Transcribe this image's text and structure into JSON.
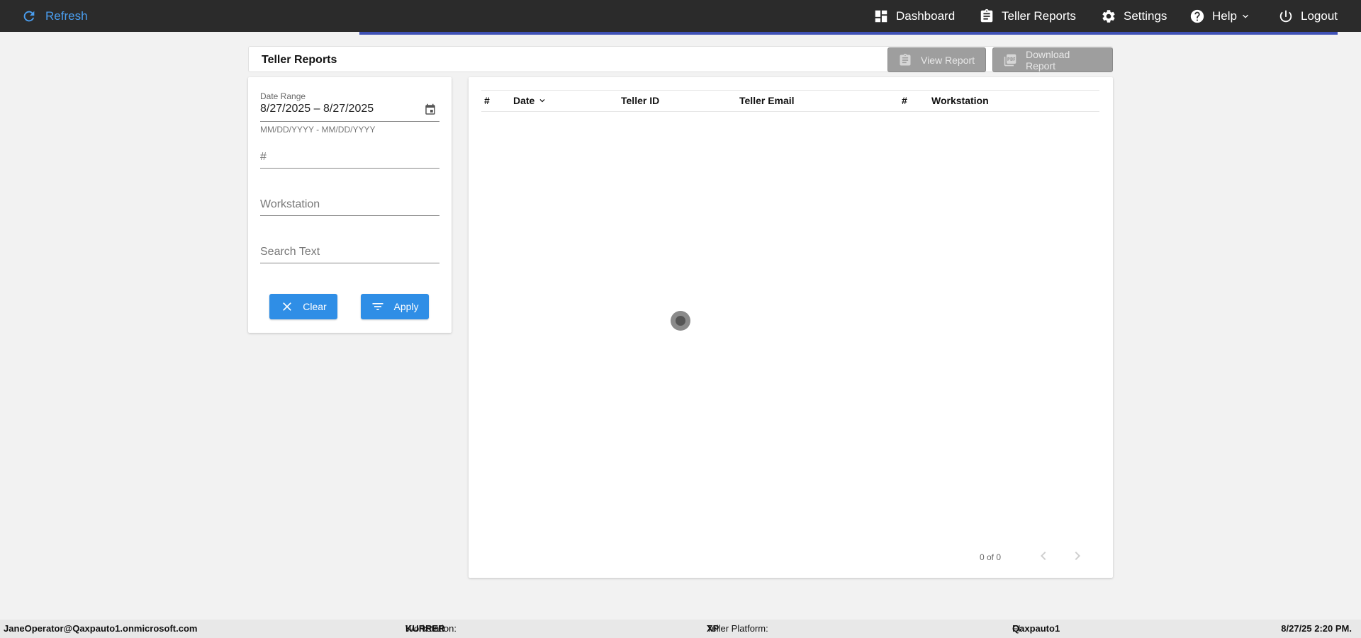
{
  "topbar": {
    "refresh_label": "Refresh",
    "nav": {
      "dashboard": "Dashboard",
      "teller_reports": "Teller Reports",
      "settings": "Settings",
      "help": "Help",
      "logout": "Logout"
    }
  },
  "page": {
    "title": "Teller Reports",
    "view_report_label": "View Report",
    "download_report_label": "Download Report"
  },
  "filters": {
    "date_range_label": "Date Range",
    "date_range_value": "8/27/2025 – 8/27/2025",
    "date_range_hint": "MM/DD/YYYY - MM/DD/YYYY",
    "number_placeholder": "#",
    "workstation_placeholder": "Workstation",
    "search_placeholder": "Search Text",
    "clear_label": "Clear",
    "apply_label": "Apply"
  },
  "table": {
    "columns": [
      "#",
      "Date",
      "Teller ID",
      "Teller Email",
      "#",
      "Workstation"
    ],
    "rows": [],
    "pagination": "0 of 0"
  },
  "footer": {
    "user": "JaneOperator@Qaxpauto1.onmicrosoft.com",
    "workstation_label": "Workstation: ",
    "workstation_value": "KURRER",
    "platform_label": "Teller Platform: ",
    "platform_value": "XP",
    "fi_label": "FI: ",
    "fi_value": "Qaxpauto1",
    "datetime": "8/27/25 2:20 PM."
  },
  "colors": {
    "topbar": "#2b2b2b",
    "accent_line": "#3f51b5",
    "refresh_text": "#4a9ef0",
    "primary_button": "#2f8ee6",
    "disabled_button": "#9e9e9e",
    "background": "#f2f2f2"
  },
  "icons": {
    "refresh": "refresh-icon",
    "dashboard": "dashboard-icon",
    "teller_reports": "clipboard-icon",
    "settings": "gear-icon",
    "help": "help-circle-icon",
    "logout": "power-icon",
    "view_report": "clipboard-icon",
    "download_report": "pdf-icon",
    "calendar": "calendar-icon",
    "clear": "close-icon",
    "apply": "filter-icon",
    "sort": "chevron-down-icon",
    "pager_prev": "chevron-left-icon",
    "pager_next": "chevron-right-icon"
  }
}
